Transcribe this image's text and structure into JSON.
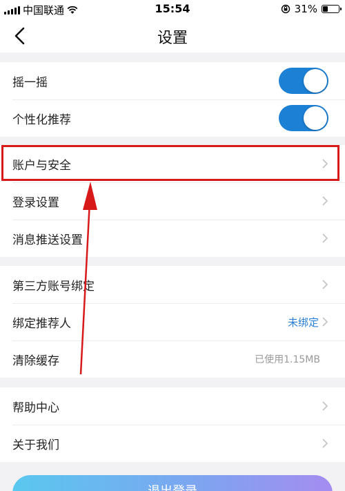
{
  "status_bar": {
    "carrier": "中国联通",
    "time": "15:54",
    "battery": "31%",
    "battery_level": 0.31
  },
  "nav": {
    "title": "设置",
    "back_icon": "chevron-left-icon"
  },
  "groups": [
    {
      "items": [
        {
          "label": "摇一摇",
          "control": "toggle",
          "on": true
        },
        {
          "label": "个性化推荐",
          "control": "toggle",
          "on": true
        }
      ]
    },
    {
      "items": [
        {
          "label": "账户与安全",
          "control": "chevron"
        },
        {
          "label": "登录设置",
          "control": "chevron"
        },
        {
          "label": "消息推送设置",
          "control": "chevron"
        }
      ]
    },
    {
      "items": [
        {
          "label": "第三方账号绑定",
          "control": "chevron"
        },
        {
          "label": "绑定推荐人",
          "control": "chevron",
          "value": "未绑定"
        },
        {
          "label": "清除缓存",
          "value": "已使用1.15MB"
        }
      ]
    },
    {
      "items": [
        {
          "label": "帮助中心",
          "control": "chevron"
        },
        {
          "label": "关于我们",
          "control": "chevron"
        }
      ]
    }
  ],
  "logout_label": "退出登录",
  "colors": {
    "toggle_on": "#1c80d4",
    "link": "#2a7fd8",
    "annotation_red": "#d8191a"
  }
}
